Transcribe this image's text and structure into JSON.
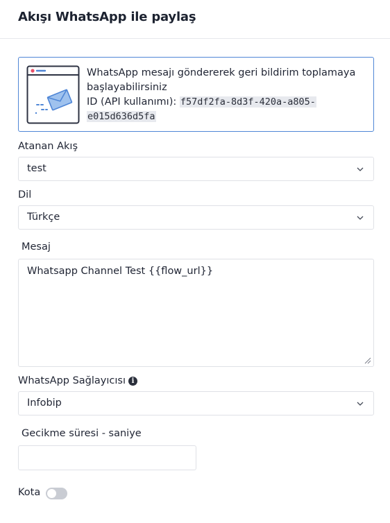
{
  "header": {
    "title": "Akışı WhatsApp ile paylaş"
  },
  "info": {
    "line1": "WhatsApp mesajı göndererek geri bildirim toplamaya",
    "line2": "başlayabilirsiniz",
    "id_label": "ID (API kullanımı):",
    "id_part1": "f57df2fa-8d3f-420a-a805-",
    "id_part2": "e015d636d5fa",
    "illustration_icon": "envelope-window-icon"
  },
  "assigned_flow": {
    "label": "Atanan Akış",
    "value": "test"
  },
  "language": {
    "label": "Dil",
    "value": "Türkçe"
  },
  "message": {
    "label": "Mesaj",
    "value": "Whatsapp Channel Test {{flow_url}}"
  },
  "provider": {
    "label": "WhatsApp Sağlayıcısı",
    "value": "Infobip",
    "info_icon": "i"
  },
  "delay": {
    "label": "Gecikme süresi - saniye",
    "value": ""
  },
  "quota": {
    "label": "Kota",
    "enabled": false
  },
  "colors": {
    "accent": "#4f86d6",
    "toggle_off": "#c9ccd3",
    "text": "#1f2433"
  }
}
